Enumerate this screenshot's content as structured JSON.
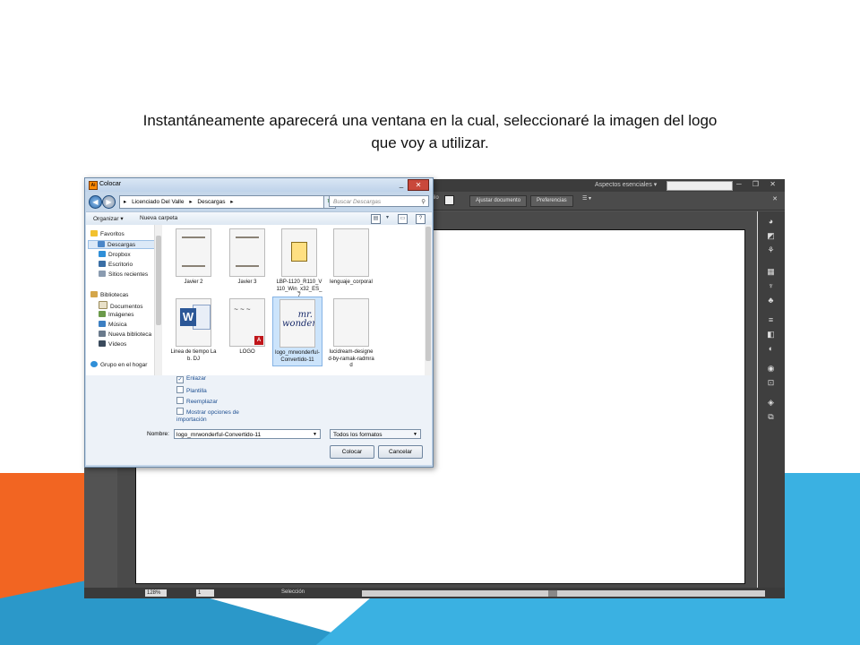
{
  "slide": {
    "caption_line1": "Instantáneamente aparecerá una ventana en la cual, seleccionaré la imagen del logo",
    "caption_line2": "que voy a utilizar."
  },
  "illustrator": {
    "workspace_label": "Aspectos esenciales",
    "window_controls": "─ ❐ ✕",
    "control_bar": {
      "style_label": "tilo",
      "adjust_document_button": "Ajustar documento",
      "preferences_button": "Preferencias"
    },
    "status_bar": {
      "zoom": "128%",
      "page": "1",
      "mode": "Selección"
    },
    "thumbnail_text": "wonderful"
  },
  "dialog": {
    "title": "Colocar",
    "address": {
      "segments": [
        "Licenciado Del Valle",
        "Descargas"
      ]
    },
    "search_placeholder": "Buscar Descargas",
    "toolbar": {
      "organize": "Organizar ▾",
      "new_folder": "Nueva carpeta"
    },
    "nav": {
      "favorites": "Favoritos",
      "downloads": "Descargas",
      "dropbox": "Dropbox",
      "desktop": "Escritorio",
      "recent": "Sitios recientes",
      "libraries": "Bibliotecas",
      "documents": "Documentos",
      "images": "Imágenes",
      "music": "Música",
      "new_library": "Nueva biblioteca",
      "videos": "Vídeos",
      "homegroup": "Grupo en el hogar"
    },
    "files": [
      {
        "name": "Javier 2",
        "kind": "scan"
      },
      {
        "name": "Javier 3",
        "kind": "scan"
      },
      {
        "name": "LBP-1120_R110_V110_Win_x32_ES_7",
        "kind": "installer"
      },
      {
        "name": "lenguaje_corporal",
        "kind": "image"
      },
      {
        "name": "Linea de tiempo Lab. DJ",
        "kind": "word"
      },
      {
        "name": "LOGO",
        "kind": "pdf"
      },
      {
        "name": "logo_mrwonderful-Convertido-11",
        "kind": "illustrator",
        "selected": true
      },
      {
        "name": "lucidream-designed-by-ramak-radmrad",
        "kind": "image"
      }
    ],
    "options": {
      "link": "Enlazar",
      "template": "Plantilla",
      "replace": "Reemplazar",
      "show_import_options": "Mostrar opciones de importación"
    },
    "name_label": "Nombre:",
    "name_value": "logo_mrwonderful-Convertido-11",
    "format_value": "Todos los formatos",
    "place_button": "Colocar",
    "cancel_button": "Cancelar"
  },
  "colors": {
    "orange": "#f26522",
    "blue": "#3ab1e2",
    "teal": "#2b98c9"
  }
}
